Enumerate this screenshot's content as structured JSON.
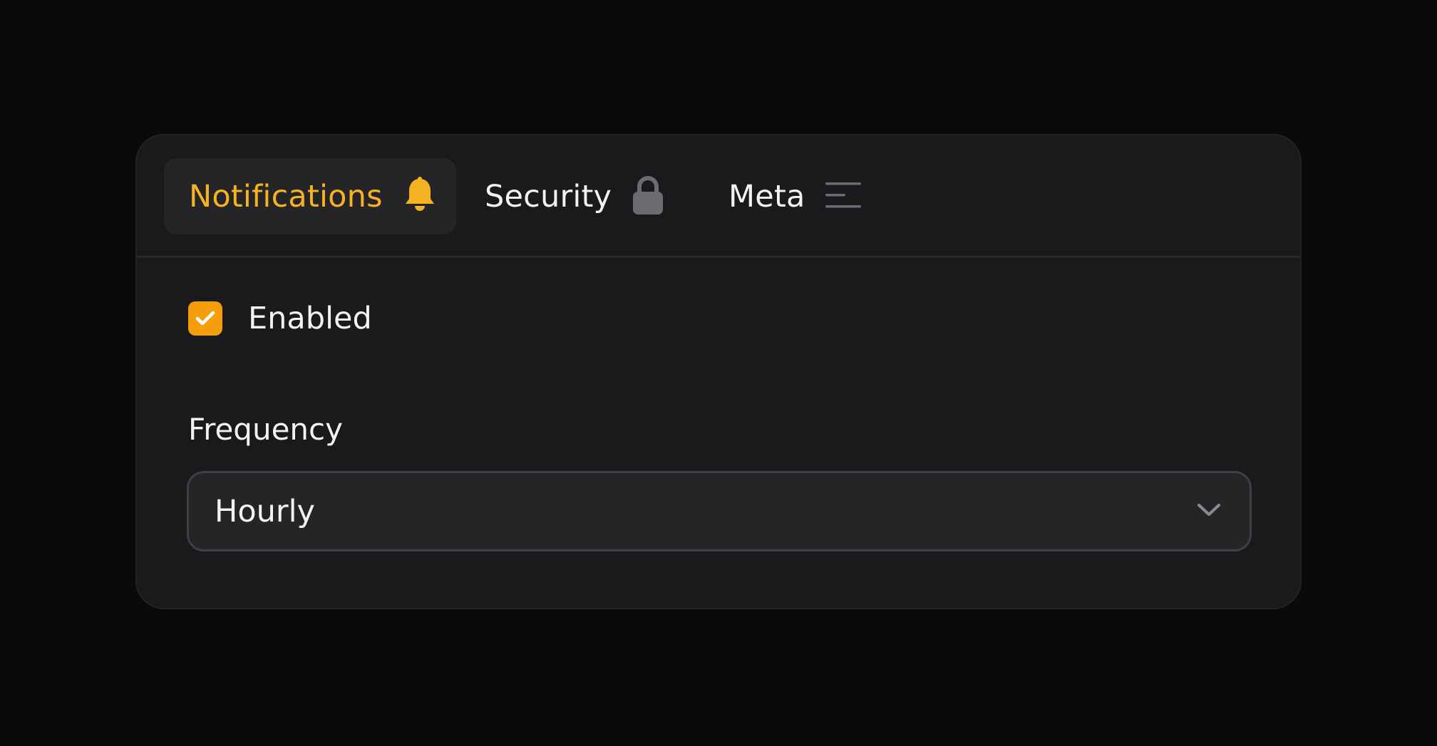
{
  "tabs": [
    {
      "label": "Notifications",
      "icon": "bell-icon",
      "active": true
    },
    {
      "label": "Security",
      "icon": "lock-icon",
      "active": false
    },
    {
      "label": "Meta",
      "icon": "menu-lines-icon",
      "active": false
    }
  ],
  "notifications": {
    "enabled_label": "Enabled",
    "enabled_checked": true,
    "frequency_label": "Frequency",
    "frequency_value": "Hourly"
  },
  "colors": {
    "accent": "#f5b324",
    "checkbox": "#f59e0b",
    "background": "#0a0a0c",
    "card": "#1a1a1c",
    "icon_muted": "#6b6b72"
  }
}
